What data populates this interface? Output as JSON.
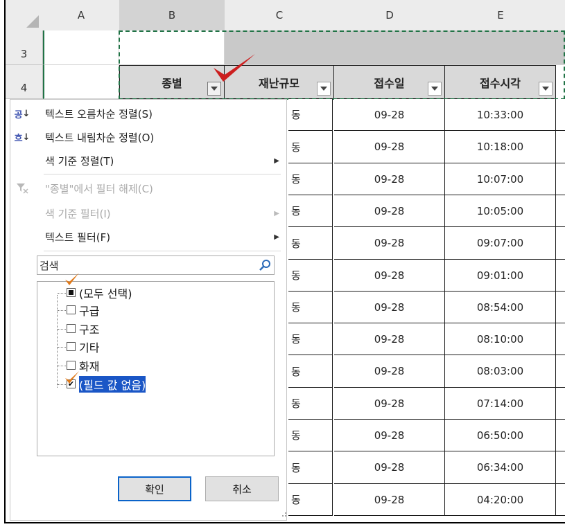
{
  "columns": [
    "A",
    "B",
    "C",
    "D",
    "E"
  ],
  "rows": [
    "3",
    "4"
  ],
  "header": {
    "type_label": "종별",
    "scale_label": "재난규모",
    "date_label": "접수일",
    "time_label": "접수시각"
  },
  "data_rows": [
    {
      "c": "동",
      "d": "09-28",
      "e": "10:33:00"
    },
    {
      "c": "동",
      "d": "09-28",
      "e": "10:18:00"
    },
    {
      "c": "동",
      "d": "09-28",
      "e": "10:07:00"
    },
    {
      "c": "동",
      "d": "09-28",
      "e": "10:05:00"
    },
    {
      "c": "동",
      "d": "09-28",
      "e": "09:07:00"
    },
    {
      "c": "동",
      "d": "09-28",
      "e": "09:01:00"
    },
    {
      "c": "동",
      "d": "09-28",
      "e": "08:54:00"
    },
    {
      "c": "동",
      "d": "09-28",
      "e": "08:10:00"
    },
    {
      "c": "동",
      "d": "09-28",
      "e": "08:03:00"
    },
    {
      "c": "동",
      "d": "09-28",
      "e": "07:14:00"
    },
    {
      "c": "동",
      "d": "09-28",
      "e": "06:50:00"
    },
    {
      "c": "동",
      "d": "09-28",
      "e": "06:34:00"
    },
    {
      "c": "동",
      "d": "09-28",
      "e": "04:20:00"
    }
  ],
  "menu": {
    "sort_asc": "텍스트 오름차순 정렬(S)",
    "sort_desc": "텍스트 내림차순 정렬(O)",
    "sort_color": "색 기준 정렬(T)",
    "clear_filter": "\"종별\"에서 필터 해제(C)",
    "filter_color": "색 기준 필터(I)",
    "text_filter": "텍스트 필터(F)",
    "sort_asc_icon_text": "공",
    "sort_desc_icon_text": "흐"
  },
  "search": {
    "placeholder": "검색"
  },
  "filter_items": [
    {
      "label": "(모두 선택)",
      "state": "partial"
    },
    {
      "label": "구급",
      "state": "unchecked"
    },
    {
      "label": "구조",
      "state": "unchecked"
    },
    {
      "label": "기타",
      "state": "unchecked"
    },
    {
      "label": "화재",
      "state": "unchecked"
    },
    {
      "label": "(필드 값 없음)",
      "state": "checked"
    }
  ],
  "buttons": {
    "ok": "확인",
    "cancel": "취소"
  },
  "colors": {
    "accent": "#217346",
    "checkmark": "#cc1f1f",
    "selection": "#1a56c6"
  }
}
